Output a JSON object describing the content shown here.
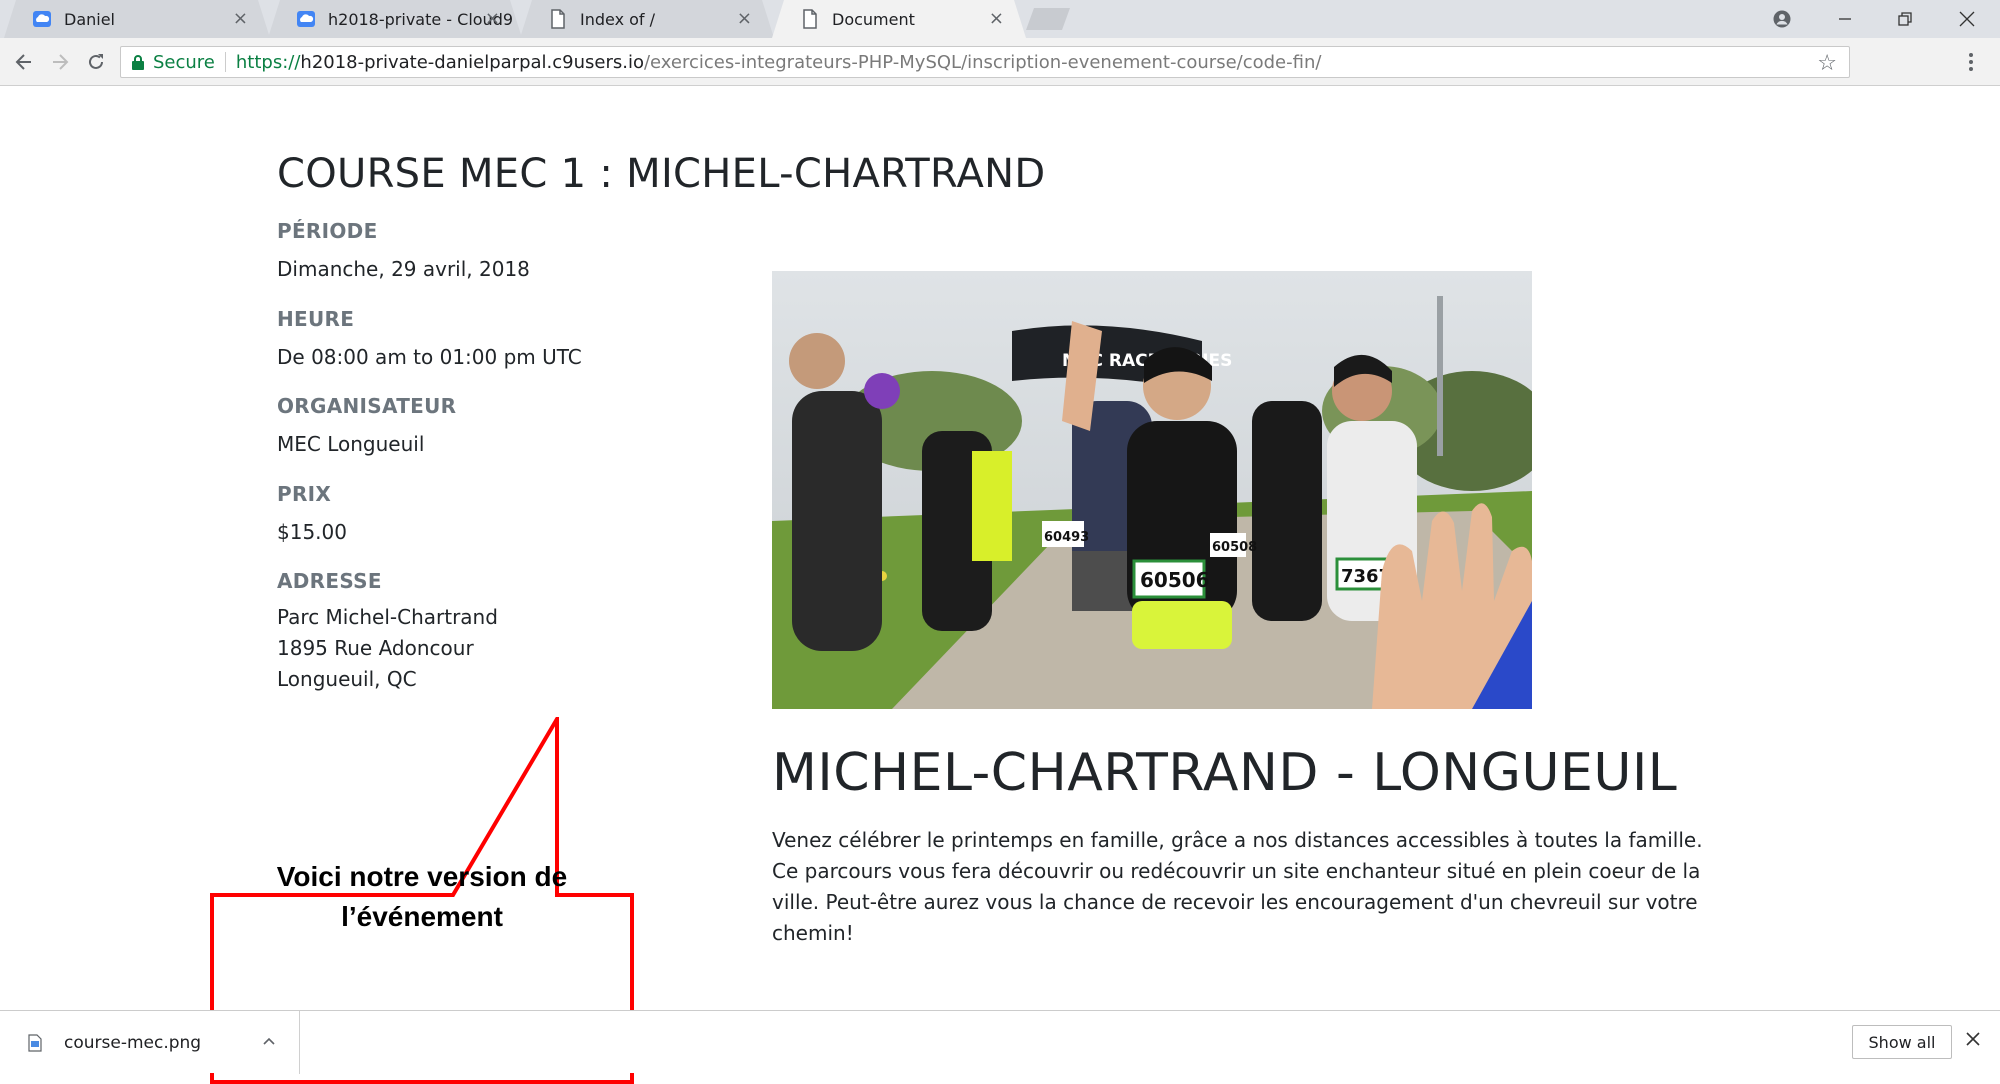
{
  "browser": {
    "tabs": [
      {
        "title": "Daniel",
        "icon": "cloud9-icon"
      },
      {
        "title": "h2018-private - Cloud9",
        "icon": "cloud9-icon"
      },
      {
        "title": "Index of /",
        "icon": "document-icon"
      },
      {
        "title": "Document",
        "icon": "document-icon",
        "active": true
      }
    ],
    "close_glyph": "×",
    "secure_label": "Secure",
    "url": {
      "scheme": "https://",
      "host": "h2018-private-danielparpal.c9users.io",
      "path": "/exercices-integrateurs-PHP-MySQL/inscription-evenement-course/code-fin/"
    }
  },
  "event": {
    "title": "COURSE MEC 1 : MICHEL-CHARTRAND",
    "fields": {
      "periode_label": "PÉRIODE",
      "periode_value": "Dimanche, 29 avril, 2018",
      "heure_label": "HEURE",
      "heure_value": "De 08:00 am to 01:00 pm UTC",
      "organisateur_label": "ORGANISATEUR",
      "organisateur_value": "MEC Longueuil",
      "prix_label": "PRIX",
      "prix_value": "$15.00",
      "adresse_label": "ADRESSE",
      "adresse_lines": [
        "Parc Michel-Chartrand",
        "1895 Rue Adoncour",
        "Longueuil, QC"
      ]
    },
    "heading": "MICHEL-CHARTRAND - LONGUEUIL",
    "description": "Venez célébrer le printemps en famille, grâce a nos distances accessibles à toutes la famille. Ce parcours vous fera découvrir ou redécouvrir un site enchanteur situé en plein coeur de la ville. Peut-être aurez vous la chance de recevoir les encouragement d'un chevreuil sur votre chemin!",
    "photo_banner": "MEC RACE SERIES",
    "photo_bibs": [
      "60506",
      "7367",
      "60493",
      "60508"
    ]
  },
  "callout": {
    "line1": "Voici notre version de",
    "line2": "l’événement",
    "border_color": "#ff0000"
  },
  "downloads": {
    "file_name": "course-mec.png",
    "show_all": "Show all"
  }
}
